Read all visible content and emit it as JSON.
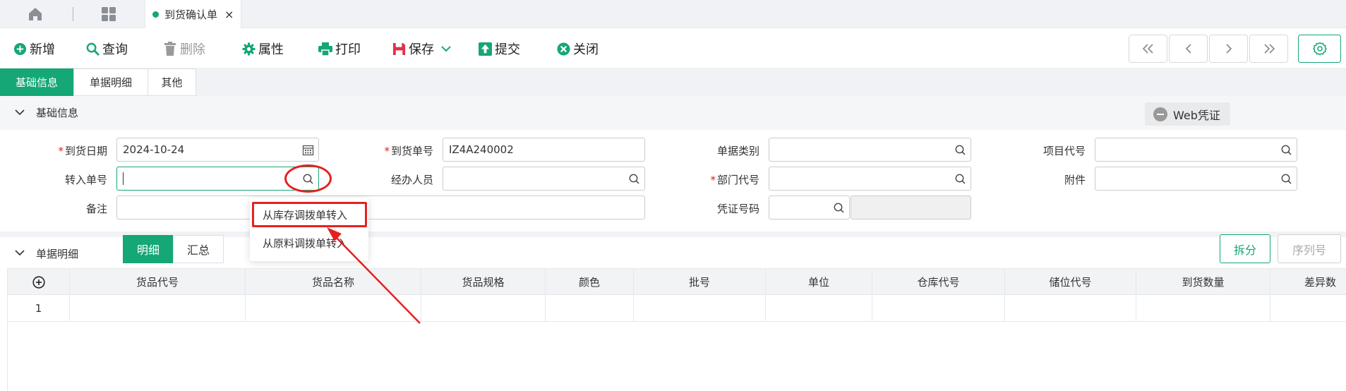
{
  "tabbar": {
    "icons": [
      "home-icon",
      "apps-grid-icon"
    ],
    "doc_tab": {
      "label": "到货确认单",
      "dot_color": "#15a776"
    }
  },
  "toolbar": {
    "new_label": "新增",
    "query_label": "查询",
    "delete_label": "删除",
    "properties_label": "属性",
    "print_label": "打印",
    "save_label": "保存",
    "submit_label": "提交",
    "close_label": "关闭",
    "nav": [
      "first-page-icon",
      "prev-page-icon",
      "next-page-icon",
      "last-page-icon"
    ],
    "accent": "#15a776"
  },
  "section_tabs": [
    {
      "label": "基础信息",
      "active": true
    },
    {
      "label": "单据明细",
      "active": false
    },
    {
      "label": "其他",
      "active": false
    }
  ],
  "basic_section": {
    "title": "基础信息",
    "web_voucher_label": "Web凭证"
  },
  "form": {
    "arrival_date": {
      "label": "到货日期",
      "required": true,
      "value": "2024-10-24"
    },
    "arrival_no": {
      "label": "到货单号",
      "required": true,
      "value": "IZ4A240002"
    },
    "doc_type": {
      "label": "单据类别",
      "value": ""
    },
    "project_code": {
      "label": "项目代号",
      "value": ""
    },
    "transfer_no": {
      "label": "转入单号",
      "value": ""
    },
    "handler": {
      "label": "经办人员",
      "value": ""
    },
    "dept_code": {
      "label": "部门代号",
      "required": true,
      "value": ""
    },
    "attachment": {
      "label": "附件",
      "value": ""
    },
    "remark": {
      "label": "备注",
      "value": ""
    },
    "voucher_no": {
      "label": "凭证号码",
      "value": ""
    }
  },
  "dropdown": {
    "items": [
      "从库存调拨单转入",
      "从原料调拨单转入"
    ]
  },
  "detail_section": {
    "title": "单据明细",
    "toggle": [
      "明细",
      "汇总"
    ],
    "split_label": "拆分",
    "serial_label": "序列号"
  },
  "grid": {
    "columns": [
      "货品代号",
      "货品名称",
      "货品规格",
      "颜色",
      "批号",
      "单位",
      "仓库代号",
      "储位代号",
      "到货数量",
      "差异数"
    ],
    "rows": [
      [
        "1"
      ]
    ]
  }
}
